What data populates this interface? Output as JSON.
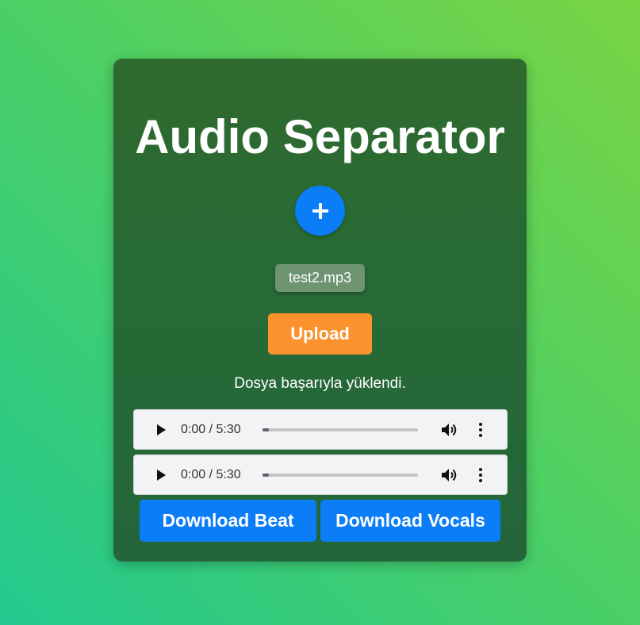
{
  "app": {
    "title": "Audio Separator"
  },
  "upload": {
    "add_icon": "plus-icon",
    "file_name": "test2.mp3",
    "upload_label": "Upload",
    "status_message": "Dosya başarıyla yüklendi."
  },
  "players": [
    {
      "time": "0:00 / 5:30",
      "progress": 0.0
    },
    {
      "time": "0:00 / 5:30",
      "progress": 0.0
    }
  ],
  "downloads": {
    "beat_label": "Download Beat",
    "vocals_label": "Download Vocals"
  },
  "colors": {
    "accent_blue": "#0a7df7",
    "upload_orange": "#fb922e",
    "card_green": "#276a36"
  }
}
